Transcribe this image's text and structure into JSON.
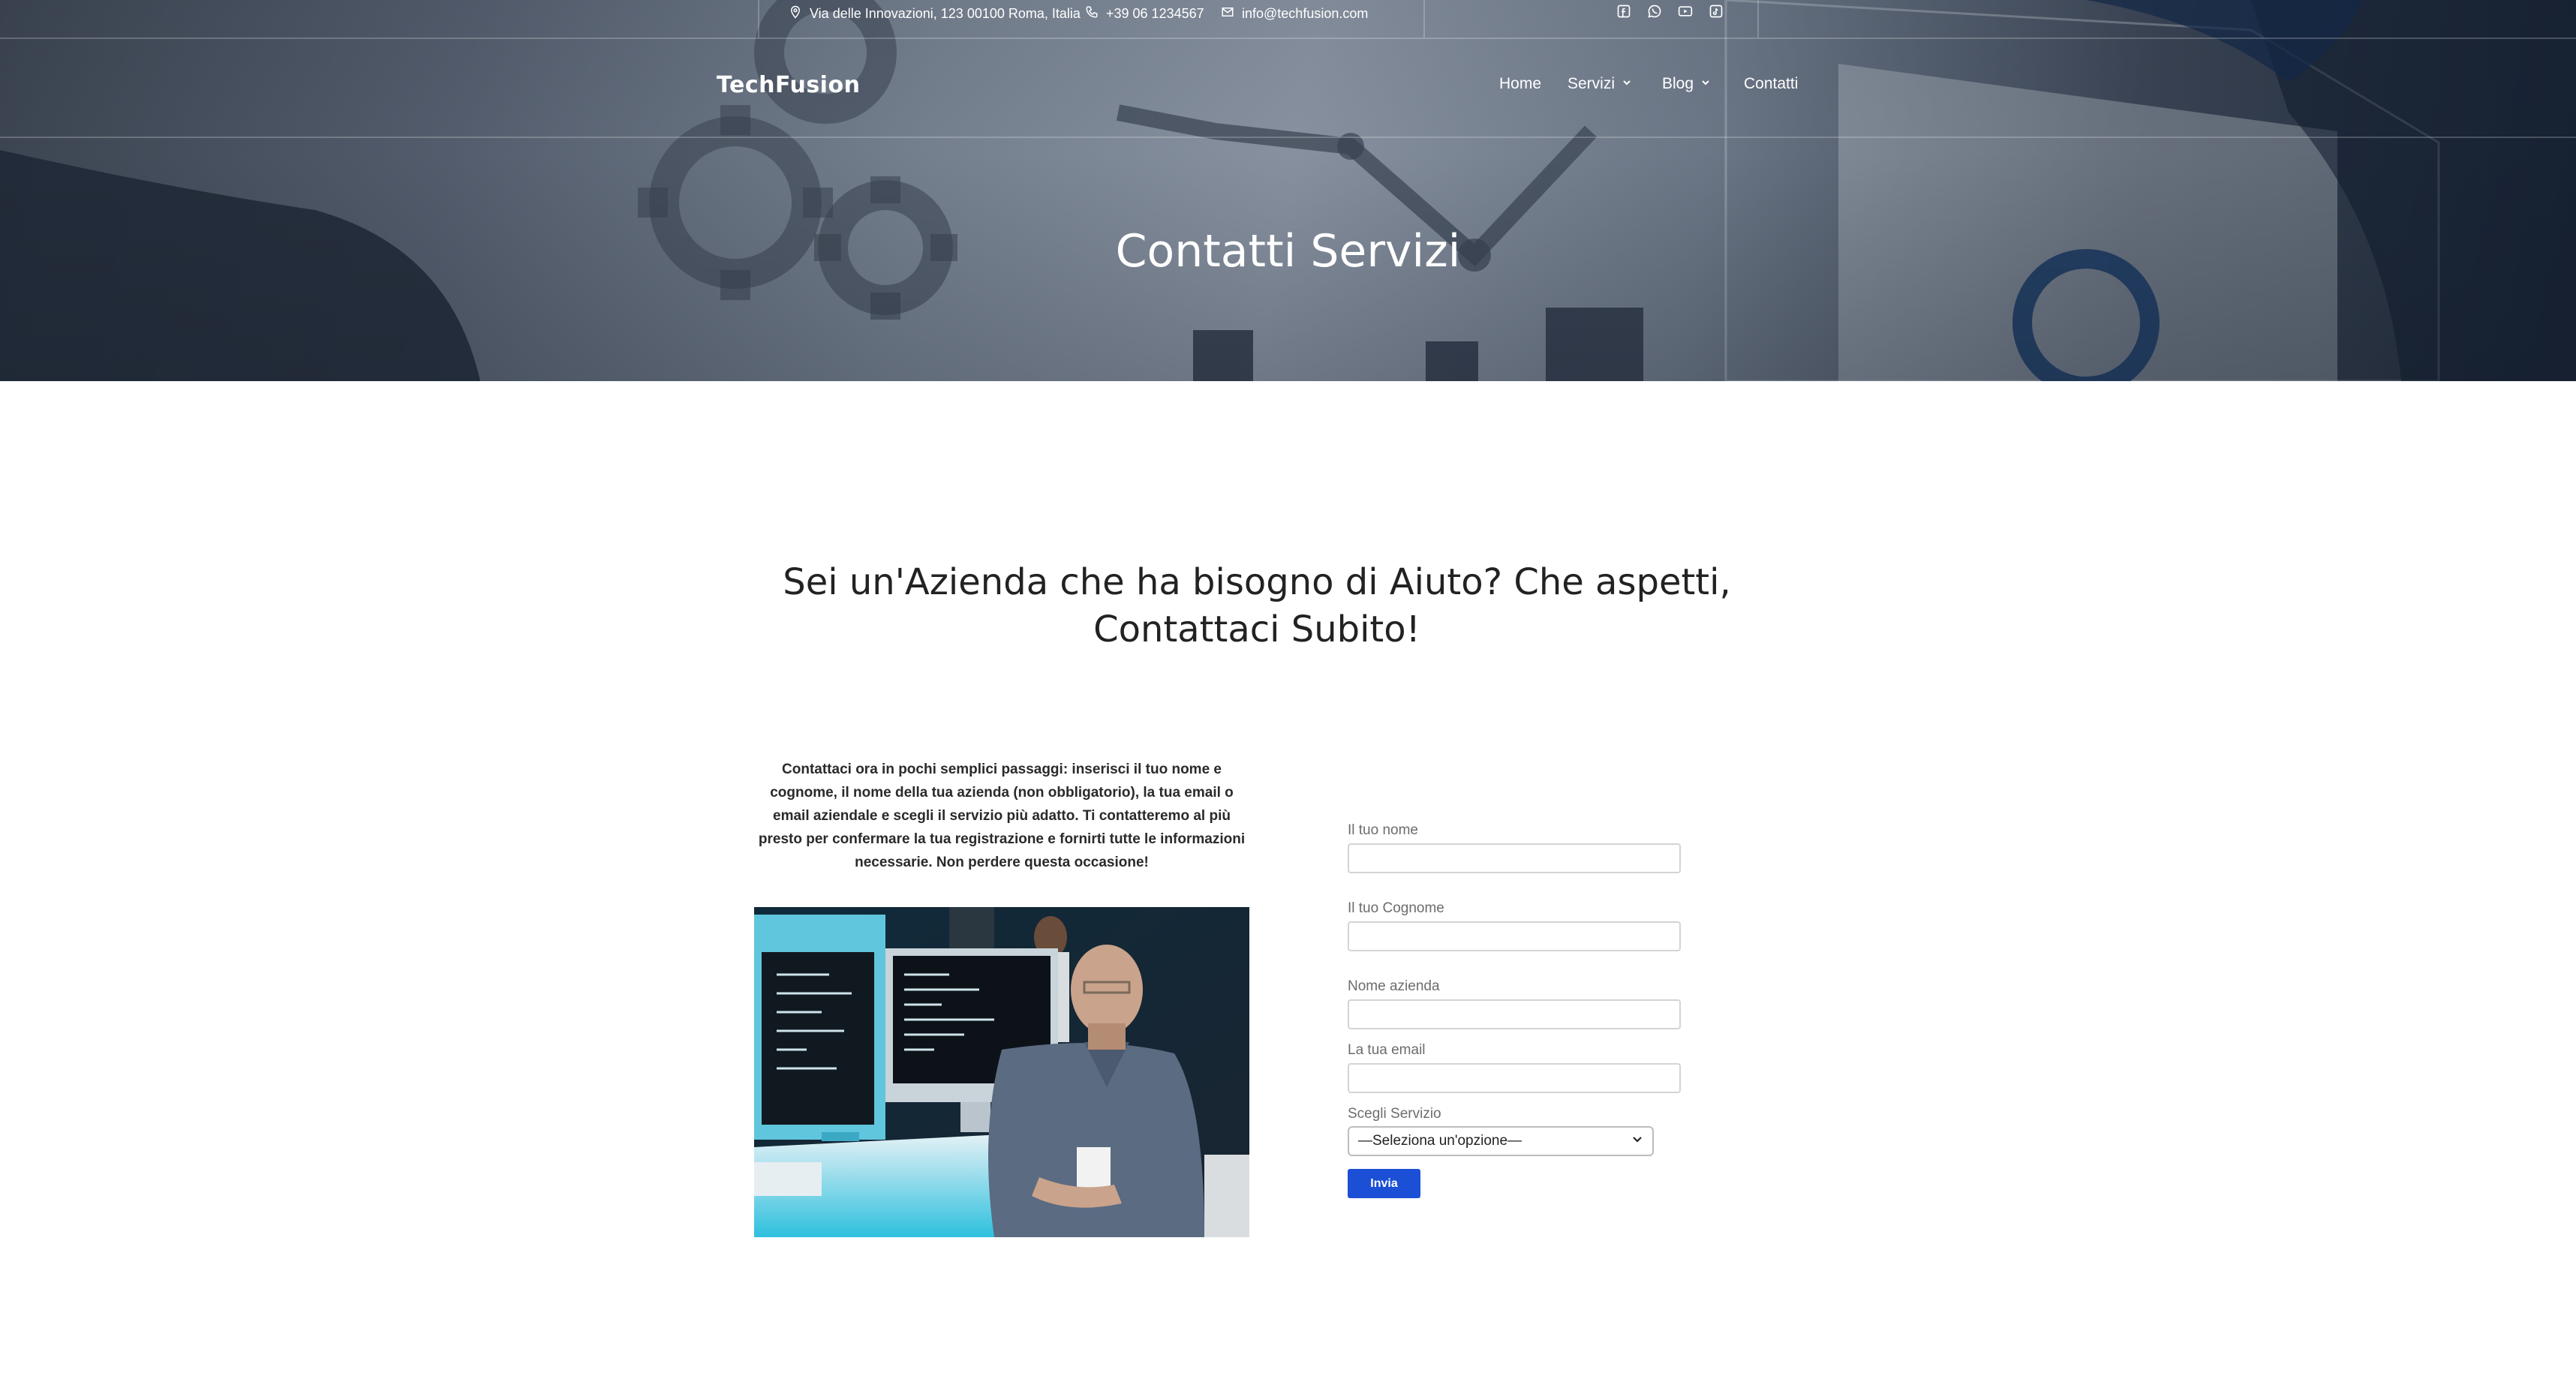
{
  "topbar": {
    "address": "Via delle Innovazioni, 123 00100 Roma, Italia",
    "phone": "+39 06 1234567",
    "email": "info@techfusion.com",
    "icons": [
      "location-pin-icon",
      "phone-icon",
      "mail-icon",
      "facebook-icon",
      "whatsapp-icon",
      "youtube-icon",
      "tiktok-icon"
    ]
  },
  "nav": {
    "logo": "TechFusion",
    "items": [
      {
        "label": "Home"
      },
      {
        "label": "Servizi",
        "dropdown": true
      },
      {
        "label": "Blog",
        "dropdown": true
      },
      {
        "label": "Contatti"
      }
    ]
  },
  "hero": {
    "title": "Contatti Servizi"
  },
  "main": {
    "headline_line1": "Sei un'Azienda che ha bisogno di Aiuto? Che aspetti,",
    "headline_line2": "Contattaci Subito!",
    "intro": "Contattaci ora in pochi semplici passaggi: inserisci il tuo nome e cognome, il nome della tua azienda (non obbligatorio), la tua email o email aziendale e scegli il servizio più adatto. Ti contatteremo al più presto per confermare la tua registrazione e fornirti tutte le informazioni necessarie. Non perdere questa occasione!"
  },
  "form": {
    "first_name_label": "Il tuo nome",
    "first_name_value": "",
    "last_name_label": "Il tuo Cognome",
    "last_name_value": "",
    "company_label": "Nome azienda",
    "company_value": "",
    "email_label": "La tua email",
    "email_value": "",
    "service_label": "Scegli Servizio",
    "service_selected": "—Seleziona un'opzione—",
    "submit_label": "Invia"
  },
  "colors": {
    "accent": "#1b4fd6",
    "hero_overlay": "#566070"
  }
}
